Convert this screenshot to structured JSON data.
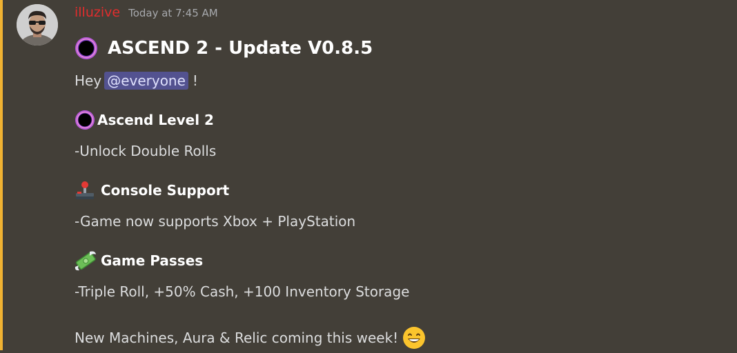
{
  "message": {
    "author": "illuzive",
    "timestamp": "Today at 7:45 AM",
    "title": "ASCEND 2 - Update V0.8.5",
    "greeting_prefix": "Hey",
    "mention": "@everyone",
    "greeting_suffix": "!",
    "sections": [
      {
        "heading": "Ascend Level 2",
        "text": "-Unlock Double Rolls",
        "icon": "black-hole-icon"
      },
      {
        "heading": "Console Support",
        "text": "-Game now supports Xbox + PlayStation",
        "icon": "joystick-icon"
      },
      {
        "heading": "Game Passes",
        "text": "-Triple Roll, +50% Cash, +100 Inventory Storage",
        "icon": "money-with-wings-icon"
      }
    ],
    "footer": "New Machines, Aura & Relic coming this week!",
    "footer_icon": "grinning-face-icon"
  },
  "colors": {
    "background": "#433f38",
    "highlight_bar": "#f0b232",
    "username": "#e12d2d",
    "mention_bg": "#535290"
  }
}
